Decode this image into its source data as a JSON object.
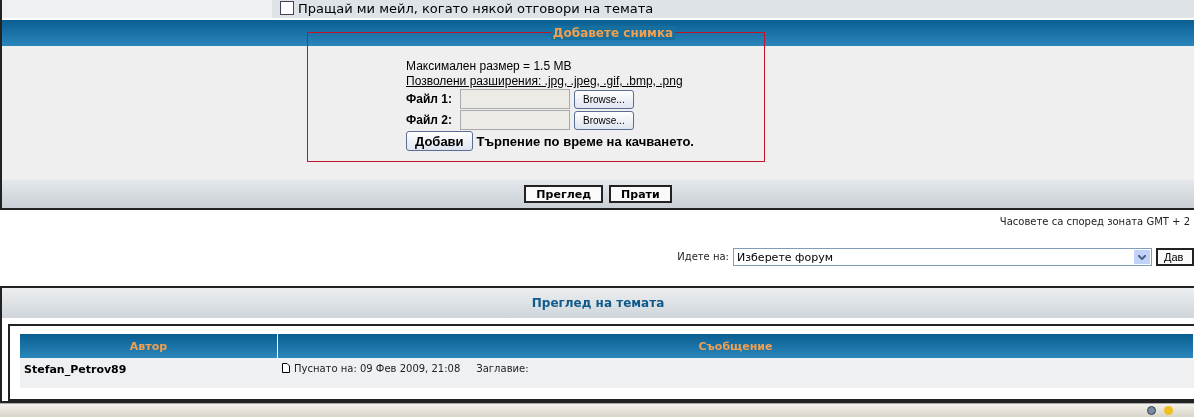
{
  "top_row": {
    "notify": {
      "label": "Пращай ми мейл, когато някой отговори на темата",
      "checked": false
    }
  },
  "upload": {
    "title": "Добавете снимка",
    "max_size": "Максимален размер = 1.5 MB",
    "extensions": "Позволени разширения: .jpg, .jpeg, .gif, .bmp, .png",
    "files": [
      {
        "label": "Файл 1:",
        "button": "Browse..."
      },
      {
        "label": "Файл 2:",
        "button": "Browse..."
      }
    ],
    "add_button": "Добави",
    "note": "Търпение по време на качването."
  },
  "actions": [
    "Преглед",
    "Прати"
  ],
  "timezone": "Часовете са според зоната GMT + 2",
  "jump": {
    "label": "Идете на:",
    "value": "Изберете форум",
    "button": "Дав"
  },
  "topic_review": {
    "title": "Преглед на темата",
    "columns": [
      "Автор",
      "Съобщение"
    ],
    "rows": [
      {
        "author": "Stefan_Petrov89",
        "posted": "Пуснато на: 09 Фев 2009, 21:08",
        "subject_label": "Заглавие:"
      }
    ]
  }
}
